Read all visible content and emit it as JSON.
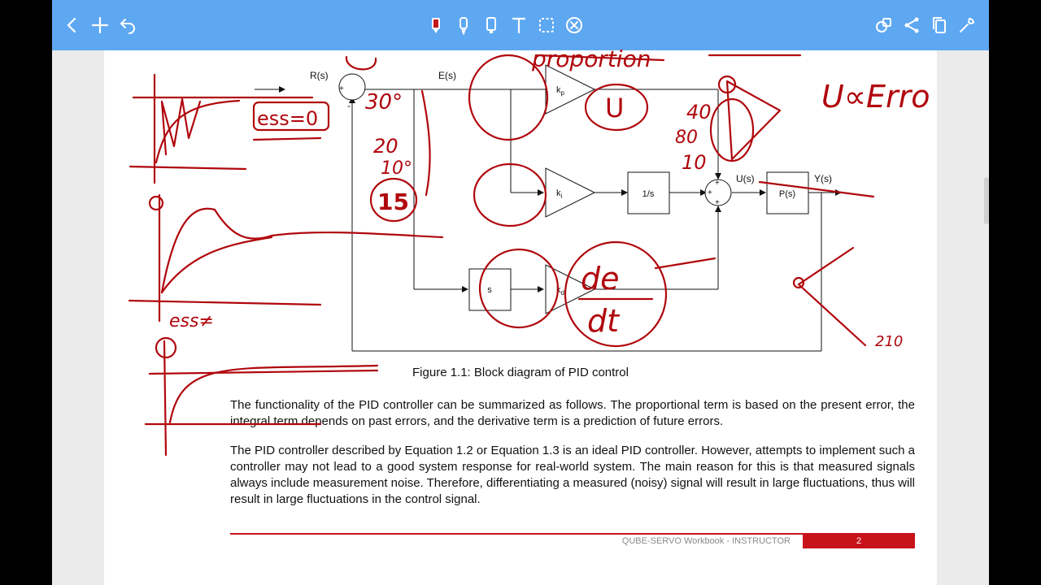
{
  "toolbar": {
    "left_icons": [
      "chevron-left-icon",
      "plus-icon",
      "undo-icon"
    ],
    "center_icons": [
      "marker-icon",
      "pen-icon",
      "highlighter-icon",
      "text-icon",
      "lasso-select-icon",
      "eraser-icon"
    ],
    "right_icons": [
      "layers-icon",
      "share-icon",
      "copy-icon",
      "settings-icon"
    ],
    "active_color": "#c4161c",
    "background": "#5ea8f2"
  },
  "diagram": {
    "signals": {
      "r": "R(s)",
      "e": "E(s)",
      "u": "U(s)",
      "y": "Y(s)"
    },
    "blocks": {
      "kp": "k",
      "kp_sub": "p",
      "ki": "k",
      "ki_sub": "i",
      "kd": "k",
      "kd_sub": "d",
      "integrator": "1/s",
      "differentiator": "s",
      "plant": "P(s)"
    },
    "signs": {
      "plus": "+",
      "minus": "-"
    }
  },
  "caption": "Figure 1.1: Block diagram of PID control",
  "paragraphs": [
    "The functionality of the PID controller can be summarized as follows. The proportional term is based on the present error, the integral term depends on past errors, and the derivative term is a prediction of future errors.",
    "The PID controller described by Equation 1.2 or Equation 1.3 is an ideal PID controller. However, attempts to implement such a controller may not lead to a good system response for real-world system. The main reason for this is that measured signals always include measurement noise. Therefore, differentiating a measured (noisy) signal will result in large fluctuations, thus will result in large fluctuations in the control signal."
  ],
  "footer": {
    "title": "QUBE-SERVO Workbook - INSTRUCTOR",
    "page": "2",
    "accent": "#c8131b"
  },
  "annotations": {
    "ink_color": "#b0070d",
    "proportional": "proportion",
    "u_alpha_error": "U∝Erro",
    "ess": "ess=0",
    "u_circled": "U",
    "angles": [
      "30°",
      "20",
      "10°",
      "15"
    ],
    "numbers": [
      "40",
      "80",
      "10"
    ],
    "derivative": {
      "num": "de",
      "den": "dt"
    },
    "ess_low": "ess≠",
    "angle_label": "210"
  }
}
